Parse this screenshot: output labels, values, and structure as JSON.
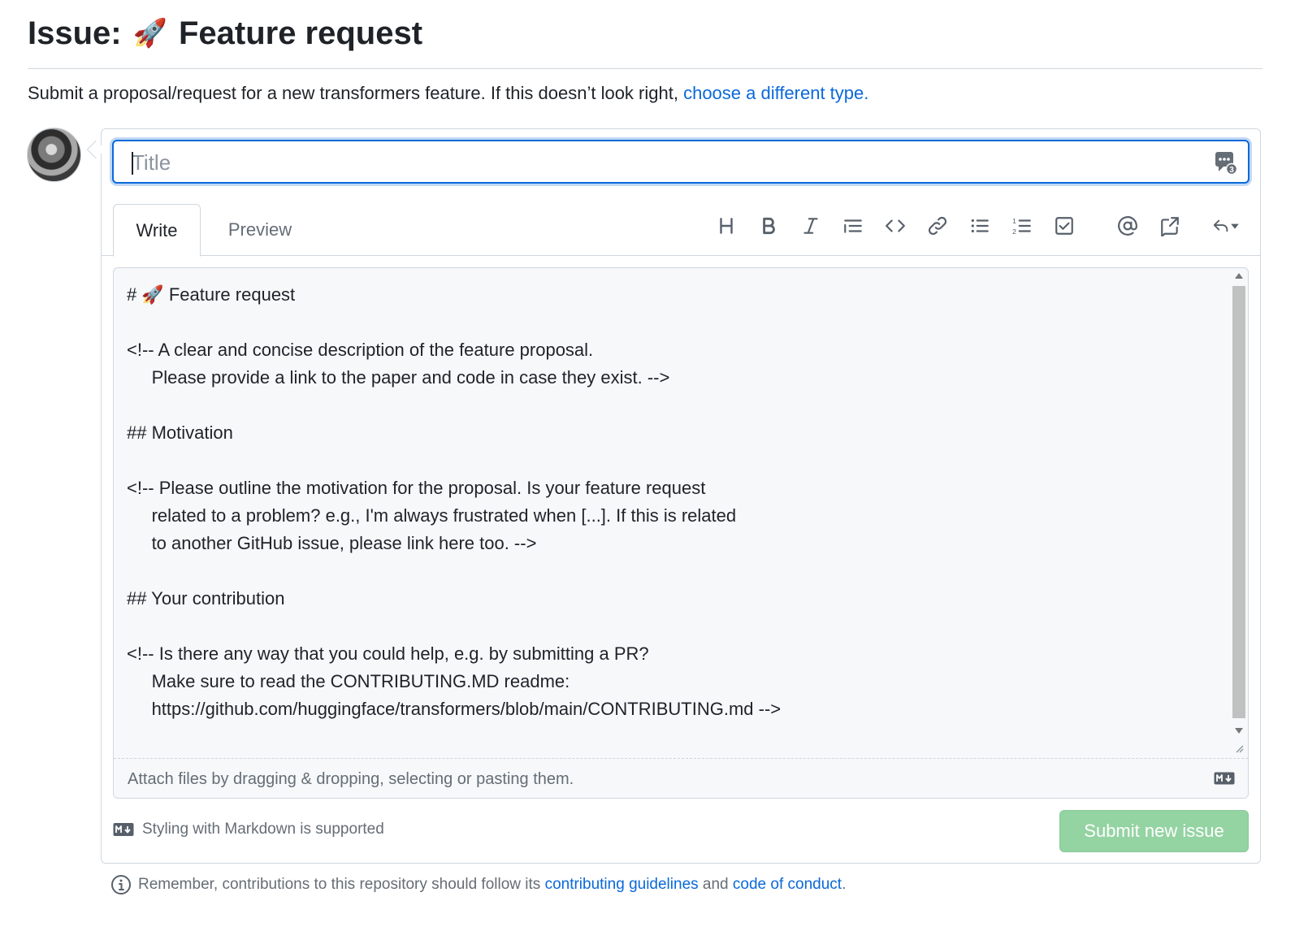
{
  "header": {
    "title_prefix": "Issue:",
    "title_emoji": "🚀",
    "title_text": "Feature request",
    "subtitle": "Submit a proposal/request for a new transformers feature. If this doesn’t look right,",
    "subtitle_link": "choose a different type."
  },
  "form": {
    "title_placeholder": "Title",
    "title_value": "",
    "tabs": [
      {
        "label": "Write",
        "active": true
      },
      {
        "label": "Preview",
        "active": false
      }
    ],
    "toolbar_icons": [
      "heading-icon",
      "bold-icon",
      "italic-icon",
      "quote-icon",
      "code-icon",
      "link-icon",
      "unordered-list-icon",
      "ordered-list-icon",
      "task-list-icon",
      "mention-icon",
      "reference-icon",
      "reply-icon"
    ],
    "body_text": "# 🚀 Feature request\n\n<!-- A clear and concise description of the feature proposal.\n     Please provide a link to the paper and code in case they exist. -->\n\n## Motivation\n\n<!-- Please outline the motivation for the proposal. Is your feature request\n     related to a problem? e.g., I'm always frustrated when [...]. If this is related\n     to another GitHub issue, please link here too. -->\n\n## Your contribution\n\n<!-- Is there any way that you could help, e.g. by submitting a PR?\n     Make sure to read the CONTRIBUTING.MD readme:\n     https://github.com/huggingface/transformers/blob/main/CONTRIBUTING.md -->",
    "attach_text": "Attach files by dragging & dropping, selecting or pasting them.",
    "markdown_support": "Styling with Markdown is supported",
    "submit_label": "Submit new issue"
  },
  "footer": {
    "text_before": "Remember, contributions to this repository should follow its",
    "link_guidelines": "contributing guidelines",
    "text_middle": "and",
    "link_conduct": "code of conduct",
    "text_after": "."
  },
  "colors": {
    "accent": "#0969da",
    "submit_bg": "#94d3a2",
    "border": "#d0d7de",
    "muted": "#656d76"
  }
}
